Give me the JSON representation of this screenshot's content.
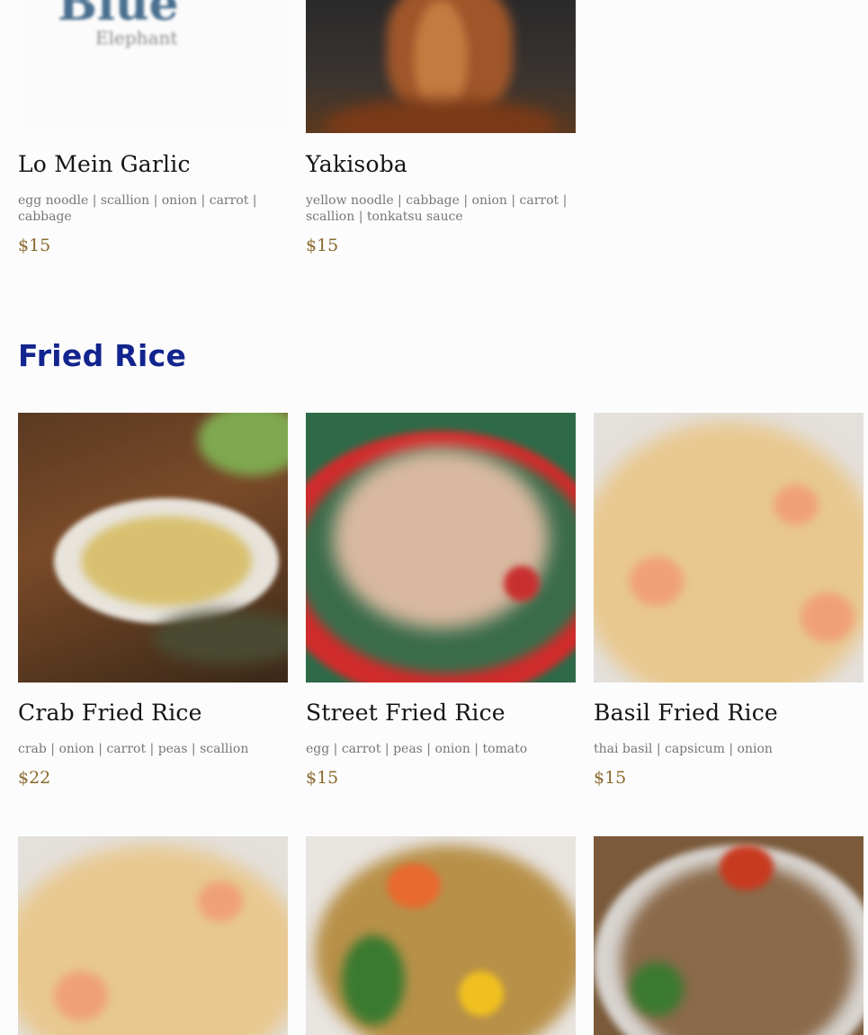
{
  "top_items": [
    {
      "name": "Lo Mein Garlic",
      "desc": "egg noodle | scallion | onion | carrot | cabbage",
      "price": "$15"
    },
    {
      "name": "Yakisoba",
      "desc": "yellow noodle | cabbage | onion | carrot | scallion | tonkatsu sauce",
      "price": "$15"
    }
  ],
  "logo": {
    "text1": "Blue",
    "text2": "Elephant"
  },
  "section": {
    "title": "Fried Rice"
  },
  "fried_rice": [
    {
      "name": "Crab Fried Rice",
      "desc": "crab | onion | carrot | peas | scallion",
      "price": "$22"
    },
    {
      "name": "Street Fried Rice",
      "desc": "egg | carrot | peas | onion | tomato",
      "price": "$15"
    },
    {
      "name": "Basil Fried Rice",
      "desc": "thai basil | capsicum | onion",
      "price": "$15"
    }
  ],
  "colors": {
    "section_title": "#12248e",
    "price": "#8b6a2e"
  }
}
